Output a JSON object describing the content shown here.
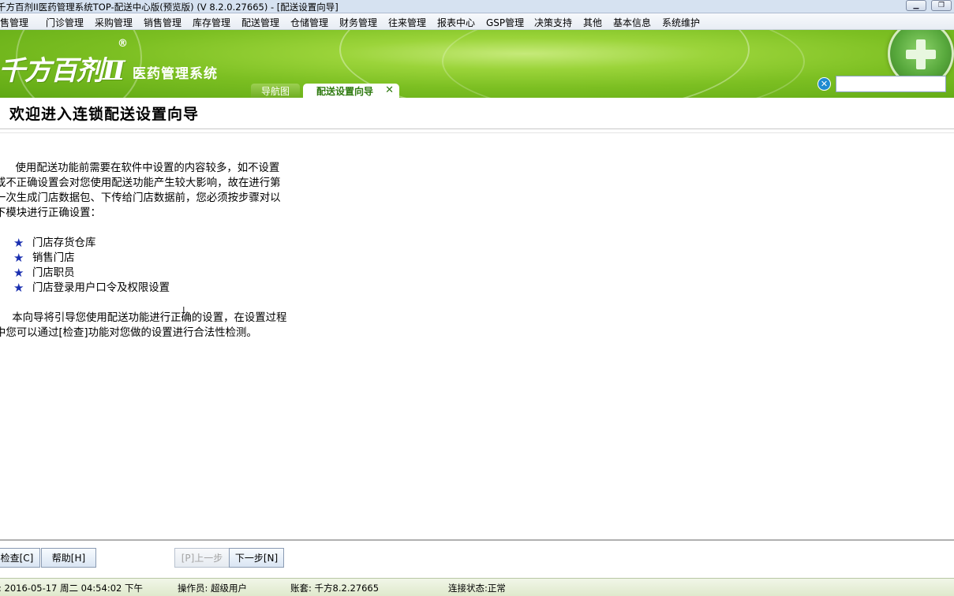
{
  "window": {
    "title": "千方百剂II医药管理系统TOP-配送中心版(预览版) (V 8.2.0.27665)   - [配送设置向导]",
    "minimize_glyph": "▁",
    "restore_glyph": "❐"
  },
  "menu": [
    "零售管理",
    "门诊管理",
    "采购管理",
    "销售管理",
    "库存管理",
    "配送管理",
    "仓储管理",
    "财务管理",
    "往来管理",
    "报表中心",
    "GSP管理",
    "决策支持",
    "其他",
    "基本信息",
    "系统维护"
  ],
  "banner": {
    "logo_text": "千方百剂Ⅱ",
    "logo_reg": "®",
    "logo_subtitle": "医药管理系统",
    "tabs": [
      {
        "label": "导航图",
        "active": false
      },
      {
        "label": "配送设置向导",
        "active": true
      }
    ],
    "tab_close_glyph": "✕",
    "search_clear_glyph": "✕",
    "search_value": ""
  },
  "page": {
    "title": "欢迎进入连锁配送设置向导",
    "intro_lines": [
      "      使用配送功能前需要在软件中设置的内容较多，如不设置",
      "或不正确设置会对您使用配送功能产生较大影响，故在进行第",
      "一次生成门店数据包、下传给门店数据前，您必须按步骤对以",
      "下模块进行正确设置："
    ],
    "bullets": [
      "门店存货仓库",
      "销售门店",
      "门店职员",
      "门店登录用户口令及权限设置"
    ],
    "bullet_glyph": "★",
    "outro_lines": [
      "     本向导将引导您使用配送功能进行正确的设置，在设置过程",
      "中您可以通过[检查]功能对您做的设置进行合法性检测。"
    ],
    "cursor_glyph": "I"
  },
  "buttons": {
    "check": "检查[C]",
    "help": "帮助[H]",
    "prev": "[P]上一步",
    "next": "下一步[N]"
  },
  "status": {
    "datetime": ": 2016-05-17 周二 04:54:02 下午",
    "operator": "操作员: 超级用户",
    "account": "账套: 千方8.2.27665",
    "connection": "连接状态:正常"
  },
  "colors": {
    "banner_green": "#7cbf22",
    "tab_active_text": "#2f7a10",
    "bullet_star": "#1a2fb0",
    "search_clear": "#1f8bd0"
  }
}
